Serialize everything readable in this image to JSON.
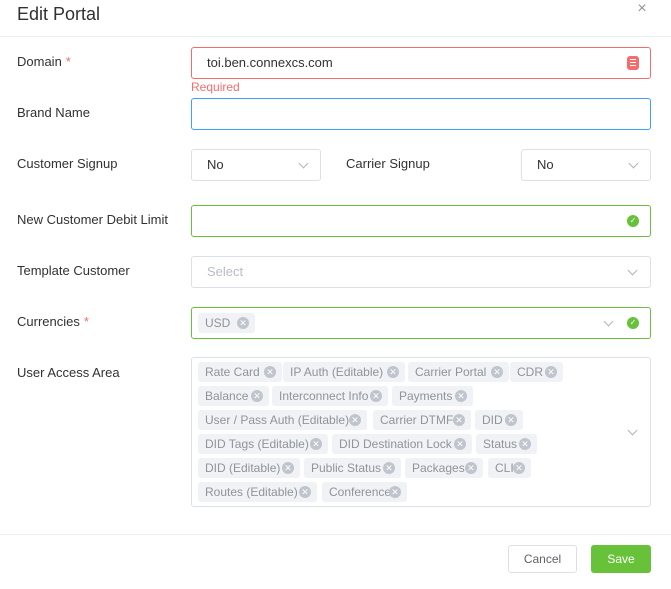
{
  "dialog": {
    "title": "Edit Portal",
    "close_glyph": "×"
  },
  "form": {
    "domain": {
      "label": "Domain",
      "required_mark": "*",
      "value": "toi.ben.connexcs.com",
      "error": "Required"
    },
    "brand_name": {
      "label": "Brand Name",
      "value": ""
    },
    "customer_signup": {
      "label": "Customer Signup",
      "value": "No"
    },
    "carrier_signup": {
      "label": "Carrier Signup",
      "value": "No"
    },
    "debit_limit": {
      "label": "New Customer Debit Limit",
      "value": ""
    },
    "template_customer": {
      "label": "Template Customer",
      "placeholder": "Select"
    },
    "currencies": {
      "label": "Currencies",
      "required_mark": "*",
      "tags": [
        "USD"
      ]
    },
    "user_access_area": {
      "label": "User Access Area",
      "tags": [
        "Rate Card",
        "IP Auth (Editable)",
        "Carrier Portal",
        "CDR",
        "Balance",
        "Interconnect Info",
        "Payments",
        "User / Pass Auth (Editable)",
        "Carrier DTMF",
        "DID",
        "DID Tags (Editable)",
        "DID Destination Lock",
        "Status",
        "DID (Editable)",
        "Public Status",
        "Packages",
        "CLI",
        "Routes (Editable)",
        "Conference"
      ]
    }
  },
  "buttons": {
    "cancel": "Cancel",
    "save": "Save"
  },
  "icons": {
    "valid": "check-circle-icon",
    "autofill": "autofill-key-icon",
    "remove_tag": "close-circle-icon",
    "dropdown": "chevron-down-icon"
  },
  "colors": {
    "error": "#f56c6c",
    "success": "#67c23a",
    "focus": "#409eff",
    "tag_bg": "#f0f2f5"
  }
}
